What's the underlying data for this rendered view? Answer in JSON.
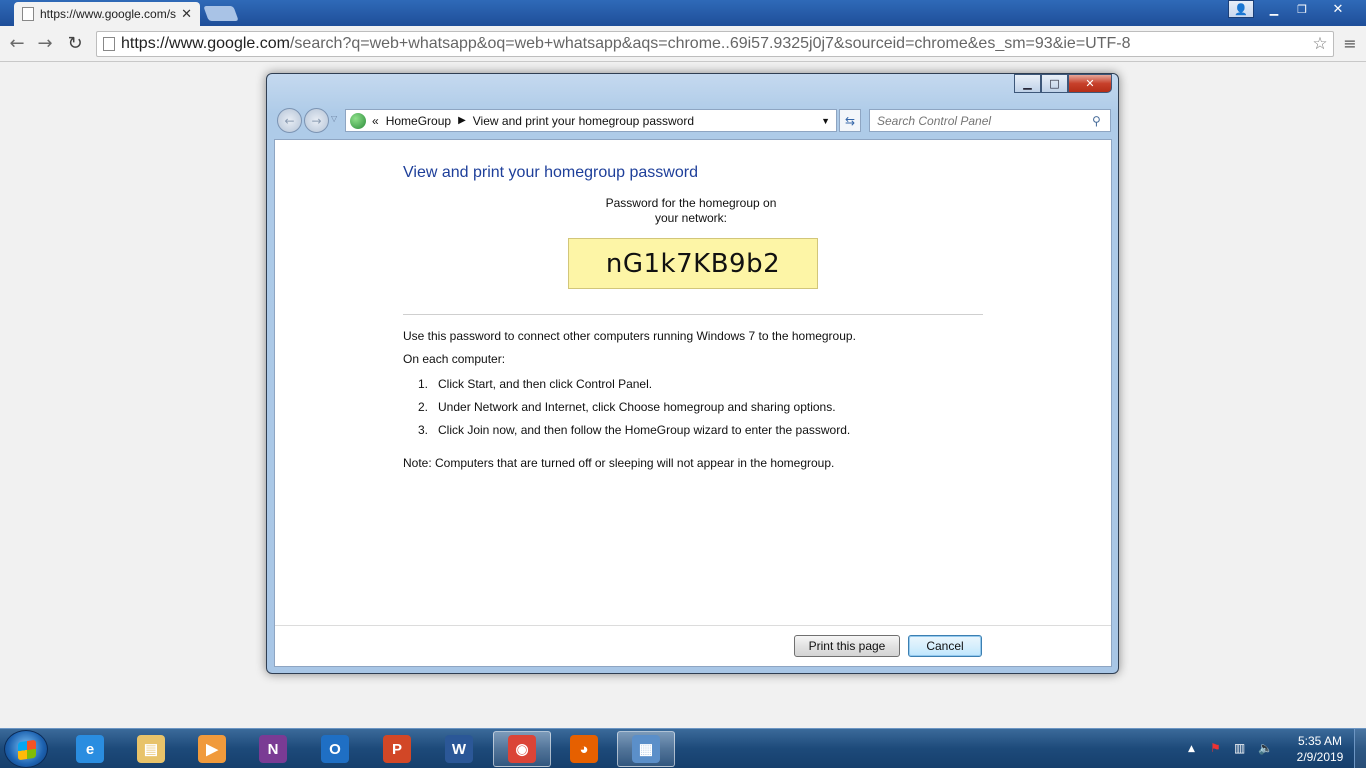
{
  "browser": {
    "tab_title": "https://www.google.com/s",
    "tab_close": "✕",
    "url_host": "https://www.google.com",
    "url_path": "/search?q=web+whatsapp&oq=web+whatsapp&aqs=chrome..69i57.9325j0j7&sourceid=chrome&es_sm=93&ie=UTF-8"
  },
  "dialog": {
    "breadcrumb": {
      "root": "HomeGroup",
      "current": "View and print your homegroup password"
    },
    "search_placeholder": "Search Control Panel",
    "title": "View and print your homegroup password",
    "password_caption_line1": "Password for the homegroup on",
    "password_caption_line2": "your network:",
    "password": "nG1k7KB9b2",
    "intro": "Use this password to connect other computers running Windows 7 to the homegroup.",
    "on_each": "On each computer:",
    "steps": [
      {
        "num": "1.",
        "text": "Click Start, and then click Control Panel."
      },
      {
        "num": "2.",
        "text": "Under Network and Internet, click Choose homegroup and sharing options."
      },
      {
        "num": "3.",
        "text": "Click Join now, and then follow the HomeGroup wizard to enter the password."
      }
    ],
    "note": "Note: Computers that are turned off or sleeping will not appear in the homegroup.",
    "print_label": "Print this page",
    "cancel_label": "Cancel"
  },
  "taskbar": {
    "time": "5:35 AM",
    "date": "2/9/2019",
    "apps": [
      {
        "name": "internet-explorer",
        "glyph": "e",
        "color": "#2a8de0"
      },
      {
        "name": "file-explorer",
        "glyph": "▤",
        "color": "#e8c36a"
      },
      {
        "name": "media-player",
        "glyph": "▶",
        "color": "#f09a3c"
      },
      {
        "name": "onenote",
        "glyph": "N",
        "color": "#7a3b94"
      },
      {
        "name": "outlook",
        "glyph": "O",
        "color": "#1f6fc4"
      },
      {
        "name": "powerpoint",
        "glyph": "P",
        "color": "#d24726"
      },
      {
        "name": "word",
        "glyph": "W",
        "color": "#2b5797"
      },
      {
        "name": "chrome",
        "glyph": "◉",
        "color": "#db4437"
      },
      {
        "name": "firefox",
        "glyph": "◕",
        "color": "#e66000"
      },
      {
        "name": "control-panel",
        "glyph": "▦",
        "color": "#5b8fc9"
      }
    ]
  }
}
